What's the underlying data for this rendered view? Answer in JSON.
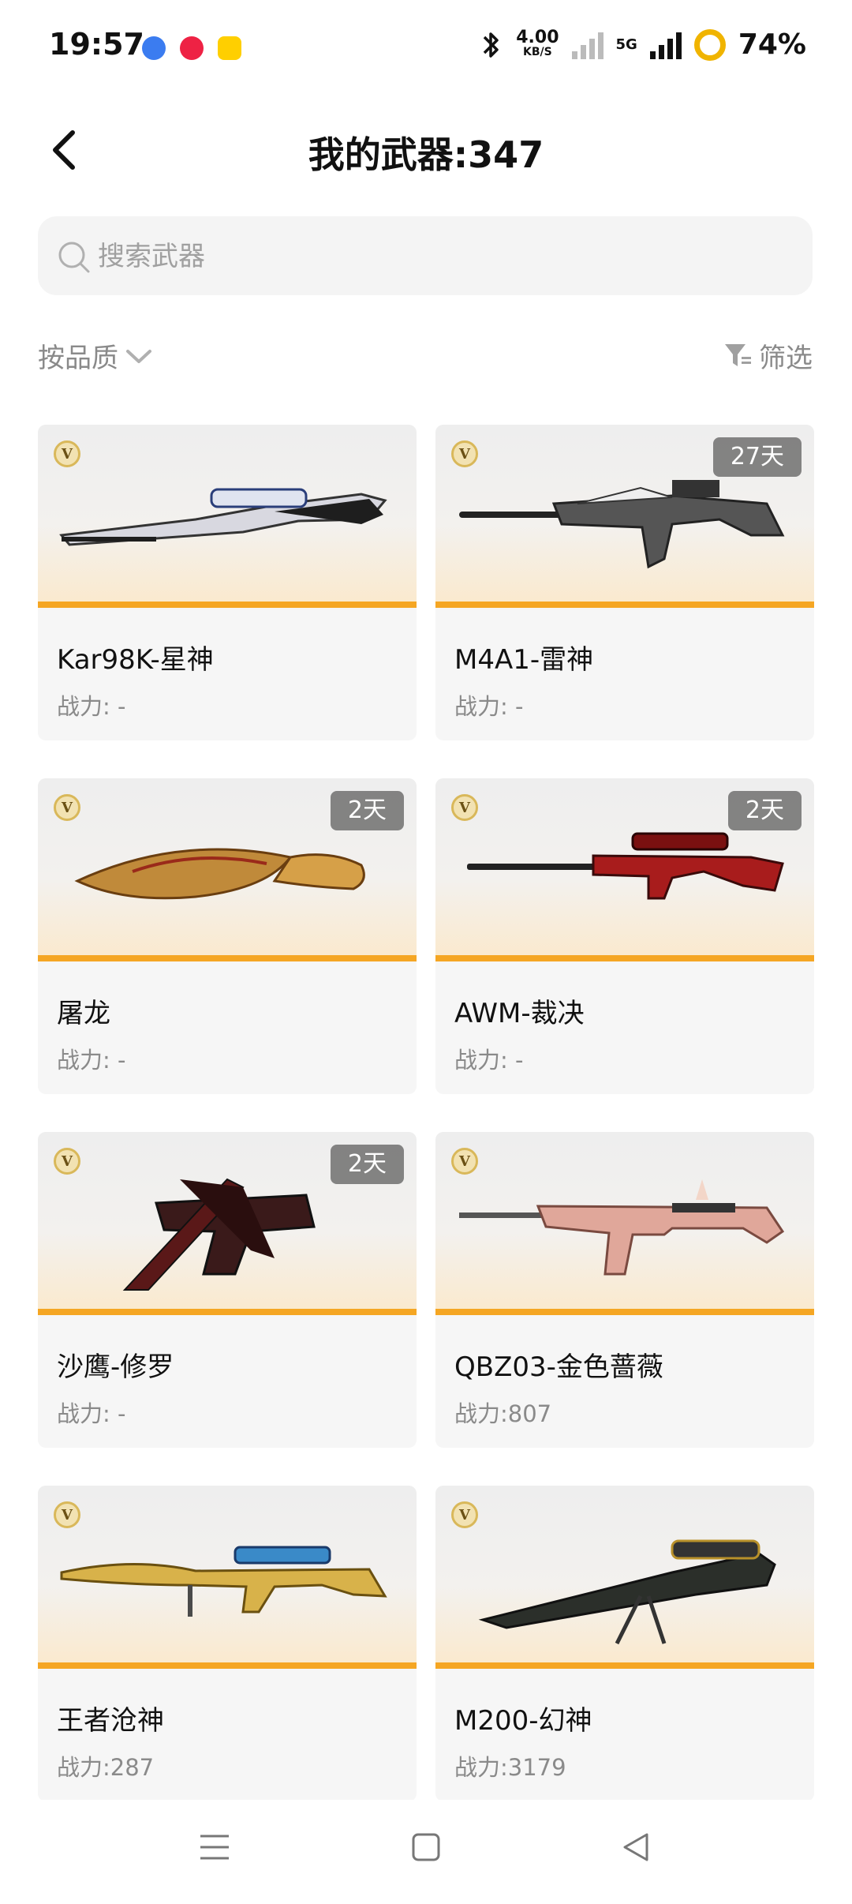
{
  "status_bar": {
    "time": "19:57",
    "net_speed_value": "4.00",
    "net_speed_unit": "KB/S",
    "network_type": "5G",
    "battery": "74%",
    "icons": [
      "bluetooth-icon",
      "wifi-off-icon",
      "signal-icon",
      "battery-ring-icon"
    ]
  },
  "header": {
    "title": "我的武器:347"
  },
  "search": {
    "placeholder": "搜索武器"
  },
  "toolbar": {
    "sort_label": "按品质",
    "filter_label": "筛选"
  },
  "weapons": [
    {
      "name": "Kar98K-星神",
      "power": "战力: -",
      "days": "",
      "badge": "V",
      "accent": "#c8c8d0"
    },
    {
      "name": "M4A1-雷神",
      "power": "战力: -",
      "days": "27天",
      "badge": "V",
      "accent": "#2d2d2d"
    },
    {
      "name": "屠龙",
      "power": "战力: -",
      "days": "2天",
      "badge": "V",
      "accent": "#b8862b"
    },
    {
      "name": "AWM-裁决",
      "power": "战力: -",
      "days": "2天",
      "badge": "V",
      "accent": "#a11c1c"
    },
    {
      "name": "沙鹰-修罗",
      "power": "战力: -",
      "days": "2天",
      "badge": "V",
      "accent": "#3a1515"
    },
    {
      "name": "QBZ03-金色蔷薇",
      "power": "战力:807",
      "days": "",
      "badge": "V",
      "accent": "#d79c8f"
    },
    {
      "name": "王者沧神",
      "power": "战力:287",
      "days": "",
      "badge": "V",
      "accent": "#d8b24a"
    },
    {
      "name": "M200-幻神",
      "power": "战力:3179",
      "days": "",
      "badge": "V",
      "accent": "#2b2f2a"
    }
  ],
  "nav": {
    "icons": [
      "menu-icon",
      "home-icon",
      "back-triangle-icon"
    ]
  }
}
